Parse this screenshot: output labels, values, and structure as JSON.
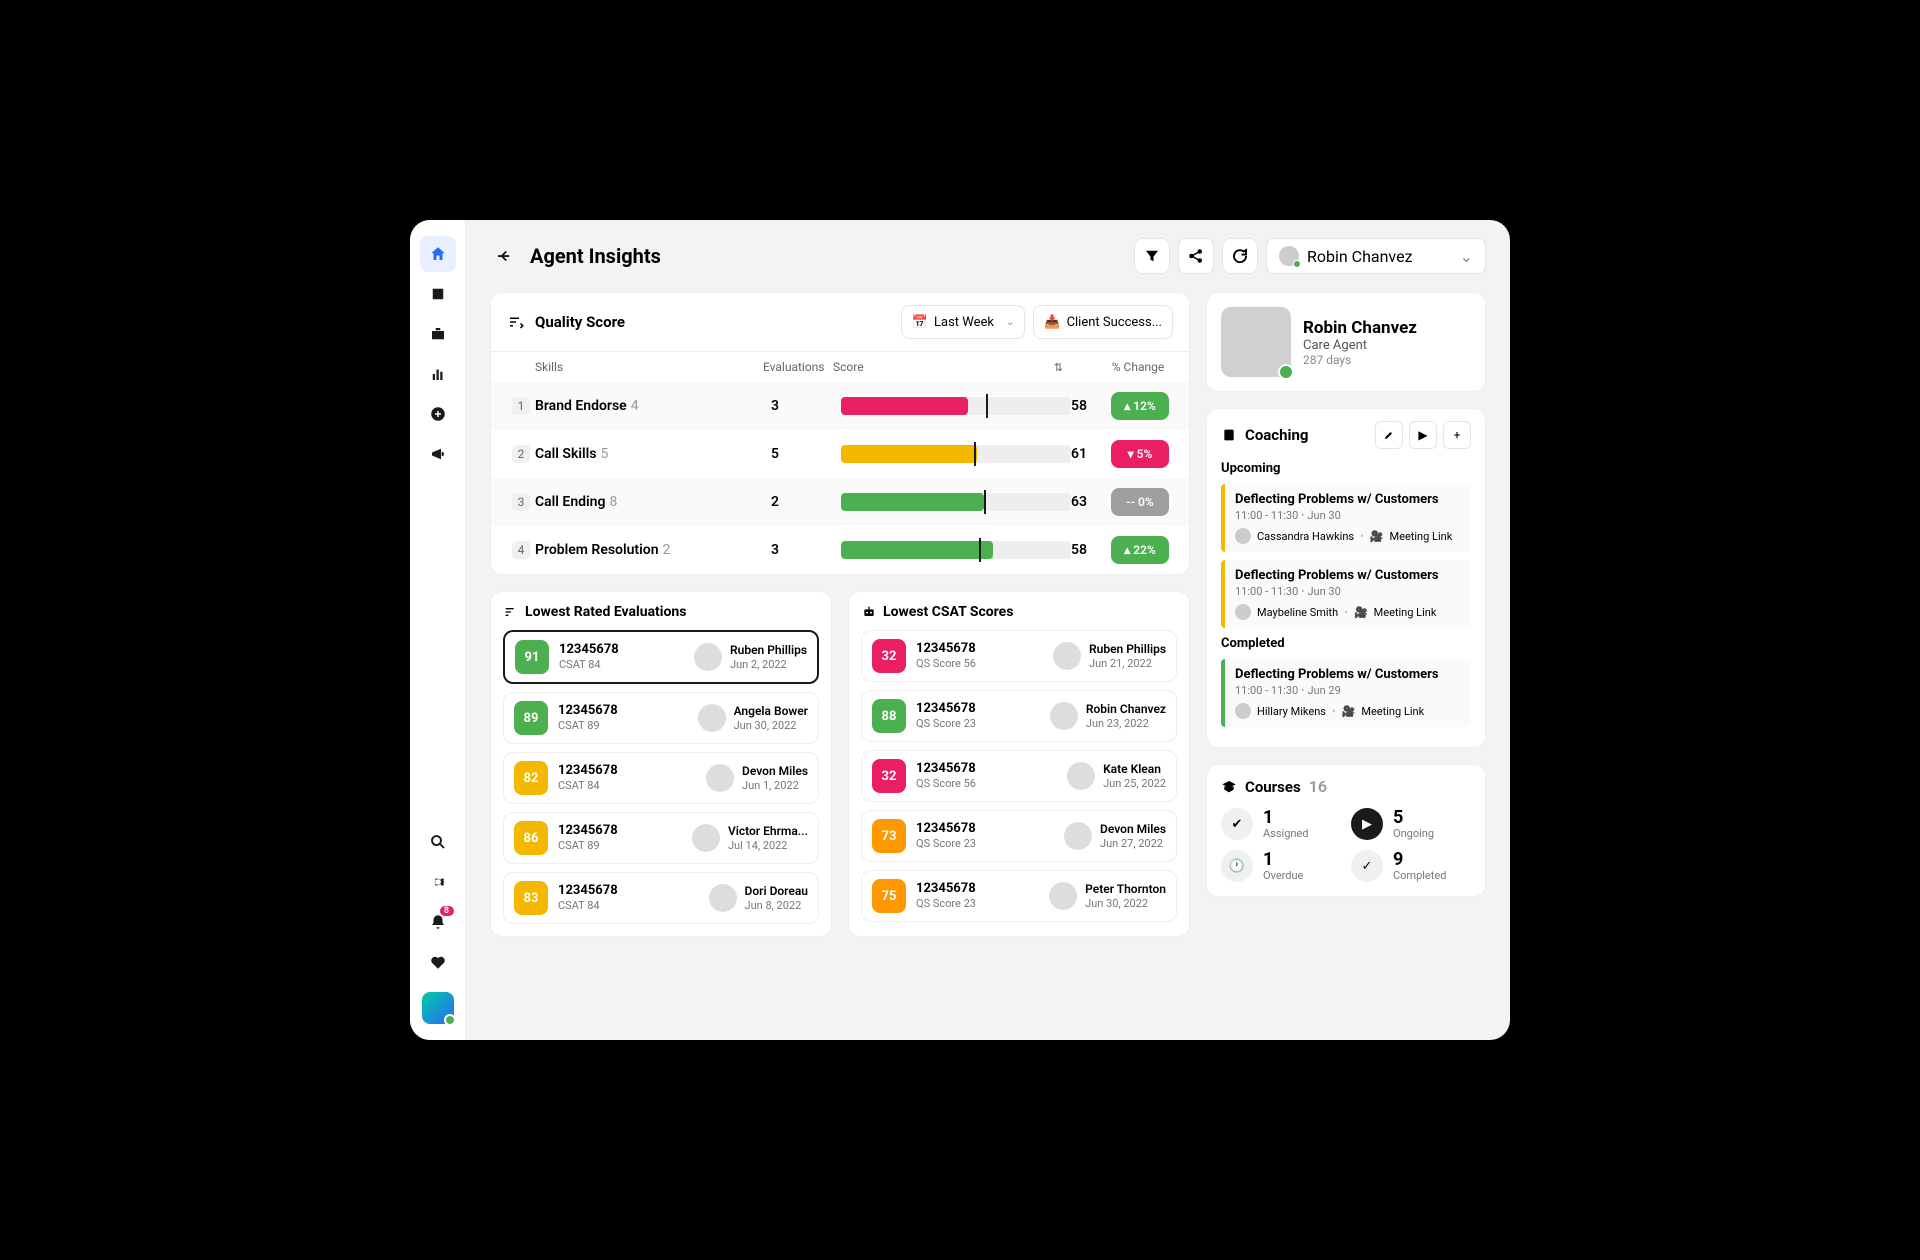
{
  "header": {
    "title": "Agent Insights",
    "userSelect": "Robin Chanvez"
  },
  "qs": {
    "title": "Quality Score",
    "filters": {
      "period": "Last Week",
      "team": "Client Success..."
    },
    "cols": {
      "skills": "Skills",
      "evals": "Evaluations",
      "score": "Score",
      "change": "% Change"
    },
    "rows": [
      {
        "n": "1",
        "skill": "Brand Endorse",
        "cnt": "4",
        "evals": "3",
        "pct": 55,
        "mark": 63,
        "color": "#e91e63",
        "score": "58",
        "chg": "12%",
        "dir": "up"
      },
      {
        "n": "2",
        "skill": "Call Skills",
        "cnt": "5",
        "evals": "5",
        "pct": 59,
        "mark": 58,
        "color": "#f5b800",
        "score": "61",
        "chg": "5%",
        "dir": "down"
      },
      {
        "n": "3",
        "skill": "Call Ending",
        "cnt": "8",
        "evals": "2",
        "pct": 62,
        "mark": 62,
        "color": "#4caf50",
        "score": "63",
        "chg": "0%",
        "dir": "flat"
      },
      {
        "n": "4",
        "skill": "Problem Resolution",
        "cnt": "2",
        "evals": "3",
        "pct": 66,
        "mark": 60,
        "color": "#4caf50",
        "score": "58",
        "chg": "22%",
        "dir": "up"
      }
    ]
  },
  "lowestEvals": {
    "title": "Lowest Rated Evaluations",
    "items": [
      {
        "score": "91",
        "cls": "sc-green",
        "id": "12345678",
        "sub": "CSAT 84",
        "name": "Ruben Phillips",
        "date": "Jun 2, 2022",
        "sel": true
      },
      {
        "score": "89",
        "cls": "sc-green",
        "id": "12345678",
        "sub": "CSAT 89",
        "name": "Angela Bower",
        "date": "Jun 30, 2022"
      },
      {
        "score": "82",
        "cls": "sc-yellow",
        "id": "12345678",
        "sub": "CSAT 84",
        "name": "Devon Miles",
        "date": "Jun 1, 2022"
      },
      {
        "score": "86",
        "cls": "sc-yellow",
        "id": "12345678",
        "sub": "CSAT 89",
        "name": "Victor Ehrma...",
        "date": "Jul 14, 2022"
      },
      {
        "score": "83",
        "cls": "sc-yellow",
        "id": "12345678",
        "sub": "CSAT 84",
        "name": "Dori Doreau",
        "date": "Jun 8, 2022"
      }
    ]
  },
  "lowestCsat": {
    "title": "Lowest CSAT Scores",
    "items": [
      {
        "score": "32",
        "cls": "sc-pink",
        "id": "12345678",
        "sub": "QS Score 56",
        "name": "Ruben Phillips",
        "date": "Jun 21, 2022"
      },
      {
        "score": "88",
        "cls": "sc-green",
        "id": "12345678",
        "sub": "QS Score 23",
        "name": "Robin Chanvez",
        "date": "Jun 23, 2022"
      },
      {
        "score": "32",
        "cls": "sc-pink",
        "id": "12345678",
        "sub": "QS Score 56",
        "name": "Kate Klean",
        "date": "Jun 25, 2022"
      },
      {
        "score": "73",
        "cls": "sc-orange",
        "id": "12345678",
        "sub": "QS Score 23",
        "name": "Devon Miles",
        "date": "Jun 27, 2022"
      },
      {
        "score": "75",
        "cls": "sc-orange",
        "id": "12345678",
        "sub": "QS Score 23",
        "name": "Peter Thornton",
        "date": "Jun 30, 2022"
      }
    ]
  },
  "profile": {
    "name": "Robin Chanvez",
    "role": "Care Agent",
    "days": "287 days"
  },
  "coaching": {
    "title": "Coaching",
    "upcomingLabel": "Upcoming",
    "completedLabel": "Completed",
    "upcoming": [
      {
        "title": "Deflecting Problems w/ Customers",
        "time": "11:00 - 11:30",
        "date": "Jun 30",
        "host": "Cassandra Hawkins",
        "link": "Meeting Link"
      },
      {
        "title": "Deflecting Problems w/ Customers",
        "time": "11:00 - 11:30",
        "date": "Jun 30",
        "host": "Maybeline Smith",
        "link": "Meeting Link"
      }
    ],
    "completed": [
      {
        "title": "Deflecting Problems w/ Customers",
        "time": "11:00 - 11:30",
        "date": "Jun 29",
        "host": "Hillary Mikens",
        "link": "Meeting Link"
      }
    ]
  },
  "courses": {
    "title": "Courses",
    "count": "16",
    "stats": [
      {
        "n": "1",
        "lbl": "Assigned",
        "icon": "check",
        "dark": false
      },
      {
        "n": "5",
        "lbl": "Ongoing",
        "icon": "play",
        "dark": true
      },
      {
        "n": "1",
        "lbl": "Overdue",
        "icon": "clock",
        "dark": false
      },
      {
        "n": "9",
        "lbl": "Completed",
        "icon": "done",
        "dark": false
      }
    ]
  },
  "notifBadge": "8"
}
